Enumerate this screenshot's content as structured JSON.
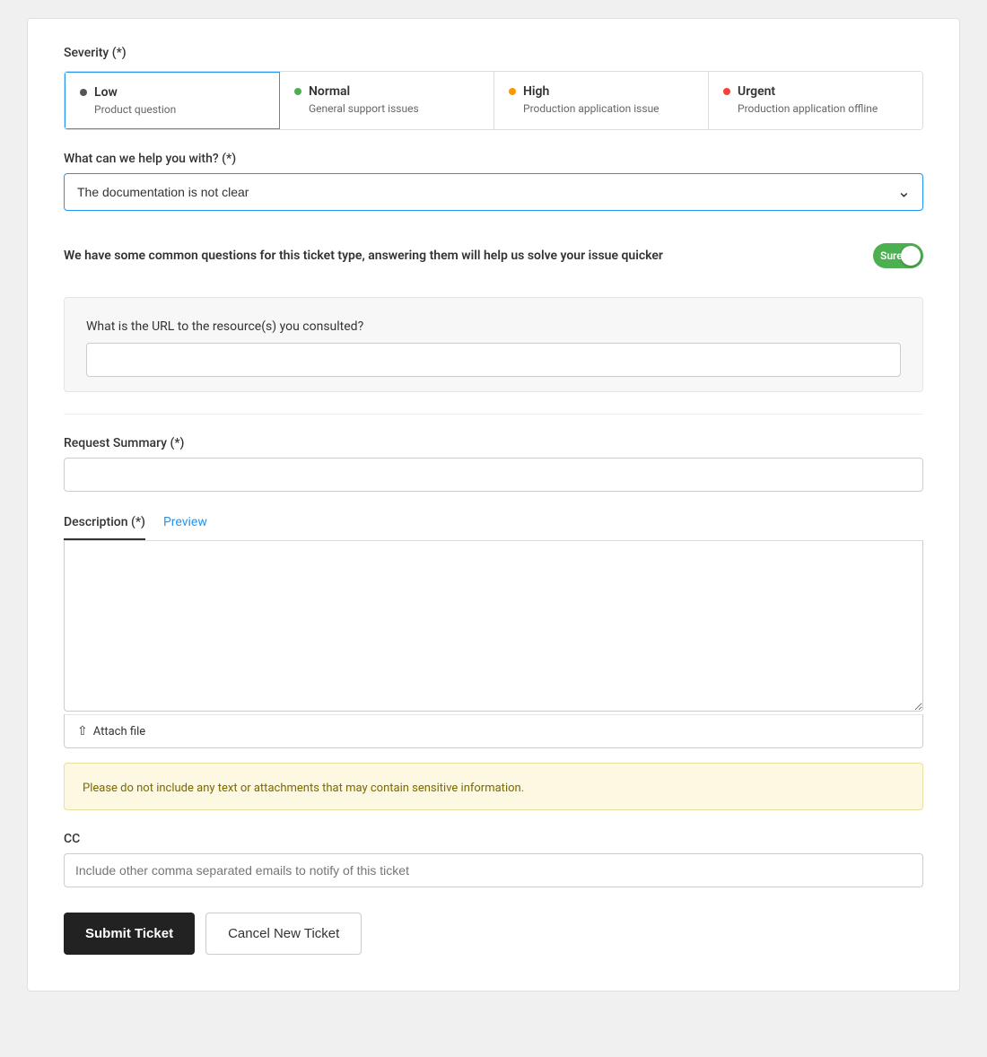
{
  "severity": {
    "label": "Severity (*)",
    "options": [
      {
        "id": "low",
        "name": "Low",
        "desc": "Product question",
        "dotClass": "dot-gray",
        "selected": true
      },
      {
        "id": "normal",
        "name": "Normal",
        "desc": "General support issues",
        "dotClass": "dot-green",
        "selected": false
      },
      {
        "id": "high",
        "name": "High",
        "desc": "Production application issue",
        "dotClass": "dot-orange",
        "selected": false
      },
      {
        "id": "urgent",
        "name": "Urgent",
        "desc": "Production application offline",
        "dotClass": "dot-red",
        "selected": false
      }
    ]
  },
  "help_with": {
    "label": "What can we help you with? (*)",
    "selected_value": "The documentation is not clear"
  },
  "common_questions": {
    "text": "We have some common questions for this ticket type, answering them will help us solve your issue quicker",
    "toggle_label": "Sure!"
  },
  "url_question": {
    "label": "What is the URL to the resource(s) you consulted?",
    "placeholder": ""
  },
  "request_summary": {
    "label": "Request Summary (*)",
    "placeholder": ""
  },
  "description": {
    "label": "Description (*)",
    "preview_label": "Preview",
    "placeholder": "",
    "attach_label": "Attach file"
  },
  "warning": {
    "text": "Please do not include any text or attachments that may contain sensitive information."
  },
  "cc": {
    "label": "CC",
    "placeholder": "Include other comma separated emails to notify of this ticket"
  },
  "buttons": {
    "submit": "Submit Ticket",
    "cancel": "Cancel New Ticket"
  }
}
